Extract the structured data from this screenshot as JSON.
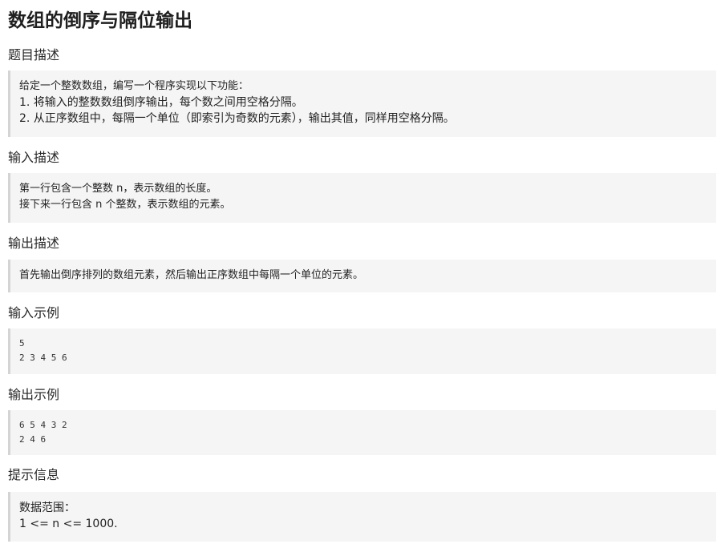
{
  "title": "数组的倒序与隔位输出",
  "sections": {
    "description": {
      "heading": "题目描述",
      "lines": [
        "给定一个整数数组，编写一个程序实现以下功能：",
        "1. 将输入的整数数组倒序输出，每个数之间用空格分隔。",
        "2. 从正序数组中，每隔一个单位（即索引为奇数的元素），输出其值，同样用空格分隔。"
      ]
    },
    "input": {
      "heading": "输入描述",
      "lines": [
        "第一行包含一个整数 n，表示数组的长度。",
        "接下来一行包含 n 个整数，表示数组的元素。"
      ]
    },
    "output": {
      "heading": "输出描述",
      "lines": [
        "首先输出倒序排列的数组元素，然后输出正序数组中每隔一个单位的元素。"
      ]
    },
    "input_example": {
      "heading": "输入示例",
      "lines": [
        "5",
        "2 3 4 5 6"
      ]
    },
    "output_example": {
      "heading": "输出示例",
      "lines": [
        "6 5 4 3 2",
        "2 4 6"
      ]
    },
    "hint": {
      "heading": "提示信息",
      "lines": [
        "数据范围：",
        "1 <= n <= 1000."
      ]
    }
  }
}
